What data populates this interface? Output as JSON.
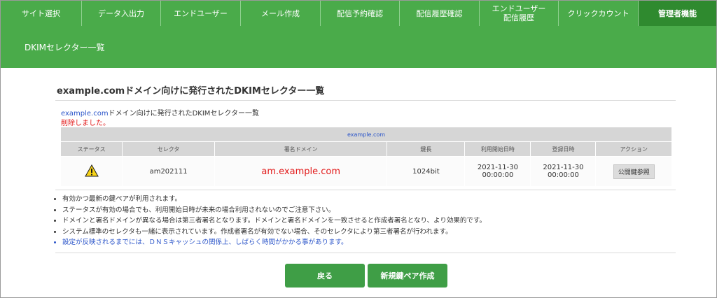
{
  "nav": {
    "tabs": [
      {
        "label": "サイト選択"
      },
      {
        "label": "データ入出力"
      },
      {
        "label": "エンドユーザー"
      },
      {
        "label": "メール作成"
      },
      {
        "label": "配信予約確認"
      },
      {
        "label": "配信履歴確認"
      },
      {
        "label": "エンドユーザー\n配信履歴"
      },
      {
        "label": "クリックカウント"
      },
      {
        "label": "管理者機能"
      }
    ],
    "active_index": 8
  },
  "subheader": {
    "title": "DKIMセレクター一覧"
  },
  "main": {
    "heading": "example.comドメイン向けに発行されたDKIMセレクター一覧",
    "line1_domain": "example.com",
    "line1_rest": "ドメイン向けに発行されたDKIMセレクター一覧",
    "deleted_message": "削除しました。",
    "table": {
      "caption": "example.com",
      "headers": [
        "ステータス",
        "セレクタ",
        "署名ドメイン",
        "鍵長",
        "利用開始日時",
        "登録日時",
        "アクション"
      ],
      "rows": [
        {
          "status_icon": "warning-icon",
          "selector": "am202111",
          "sign_domain": "am.example.com",
          "key_length": "1024bit",
          "start_date": "2021-11-30",
          "start_time": "00:00:00",
          "reg_date": "2021-11-30",
          "reg_time": "00:00:00",
          "action_label": "公開鍵参照"
        }
      ]
    },
    "notes": [
      "有効かつ最新の鍵ペアが利用されます。",
      "ステータスが有効の場合でも、利用開始日時が未来の場合利用されないのでご注意下さい。",
      "ドメインと署名ドメインが異なる場合は第三者署名となります。ドメインと署名ドメインを一致させると作成者署名となり、より効果的です。",
      "システム標準のセレクタも一緒に表示されています。作成者署名が有効でない場合、そのセレクタにより第三者署名が行われます。",
      "設定が反映されるまでには、ＤＮＳキャッシュの関係上、しばらく時間がかかる事があります。"
    ]
  },
  "buttons": {
    "back": "戻る",
    "new_keypair": "新規鍵ペア作成"
  },
  "colors": {
    "header_green": "#4aab4a",
    "active_tab": "#2f8a2f",
    "button_green": "#3f9e46",
    "error_red": "#e21b1b",
    "link_blue": "#2a54c9"
  }
}
